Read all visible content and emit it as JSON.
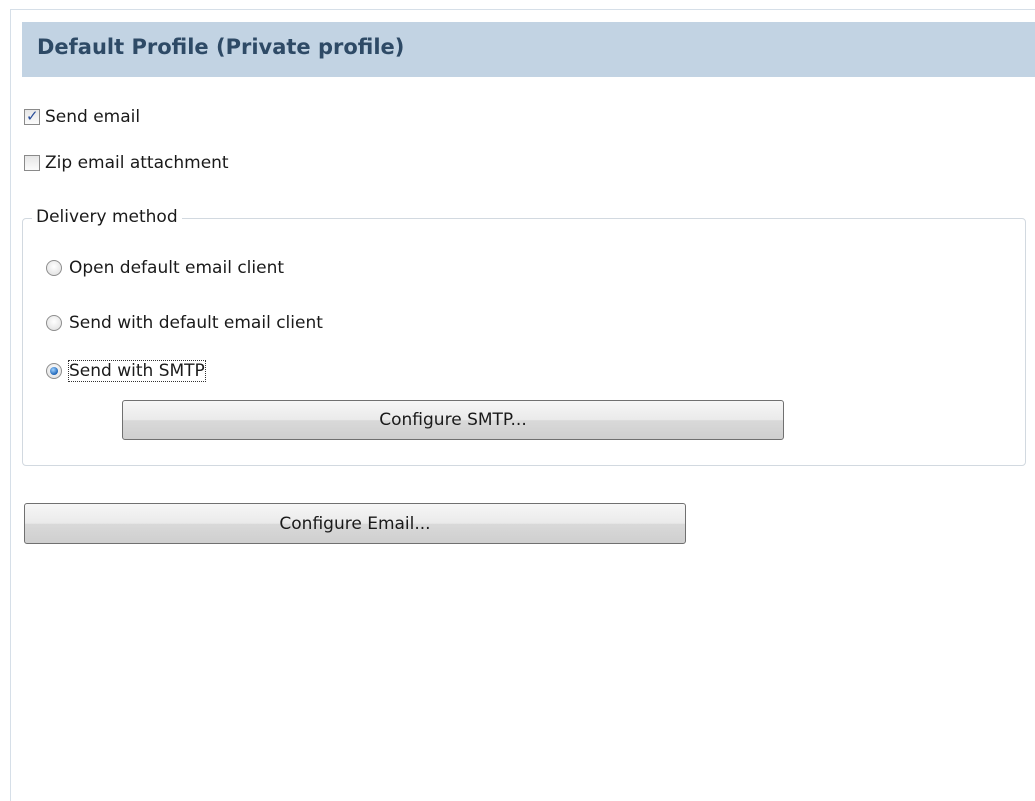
{
  "profile": {
    "title": "Default Profile (Private profile)"
  },
  "options": {
    "send_email": {
      "label": "Send email",
      "checked": true
    },
    "zip_attachment": {
      "label": "Zip email attachment",
      "checked": false
    }
  },
  "delivery": {
    "legend": "Delivery method",
    "methods": [
      {
        "label": "Open default email client",
        "selected": false
      },
      {
        "label": "Send with default email client",
        "selected": false
      },
      {
        "label": "Send with SMTP",
        "selected": true
      }
    ],
    "configure_smtp_label": "Configure SMTP..."
  },
  "configure_email_label": "Configure Email..."
}
